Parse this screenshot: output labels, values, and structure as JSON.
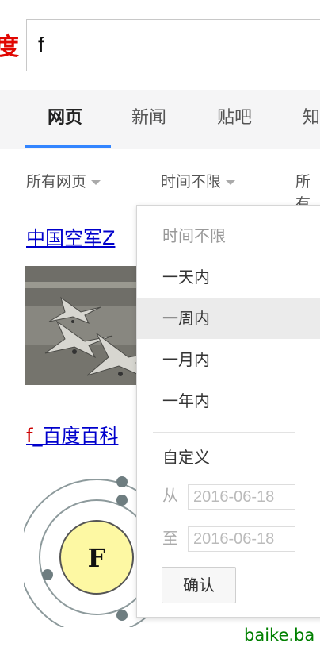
{
  "search": {
    "logo_text": "度",
    "query": "f"
  },
  "tabs": [
    {
      "label": "网页",
      "active": true
    },
    {
      "label": "新闻"
    },
    {
      "label": "贴吧"
    },
    {
      "label": "知"
    }
  ],
  "filters": [
    {
      "label": "所有网页"
    },
    {
      "label": "时间不限"
    },
    {
      "label": "所有"
    }
  ],
  "results": [
    {
      "title": "中国空军Z"
    },
    {
      "title_highlight": "f",
      "title_rest": "_百度百科"
    }
  ],
  "diagram": {
    "symbol": "F"
  },
  "baike_url": "baike.ba",
  "time_dropdown": {
    "items": [
      {
        "label": "时间不限",
        "state": "current"
      },
      {
        "label": "一天内"
      },
      {
        "label": "一周内",
        "state": "hover"
      },
      {
        "label": "一月内"
      },
      {
        "label": "一年内"
      }
    ],
    "custom_label": "自定义",
    "from_label": "从",
    "from_value": "2016-06-18",
    "to_label": "至",
    "to_value": "2016-06-18",
    "confirm_label": "确认"
  },
  "colors": {
    "brand_red": "#e10601",
    "tab_active_underline": "#3385ff",
    "link_blue": "#0000cc",
    "url_green": "#008000"
  }
}
